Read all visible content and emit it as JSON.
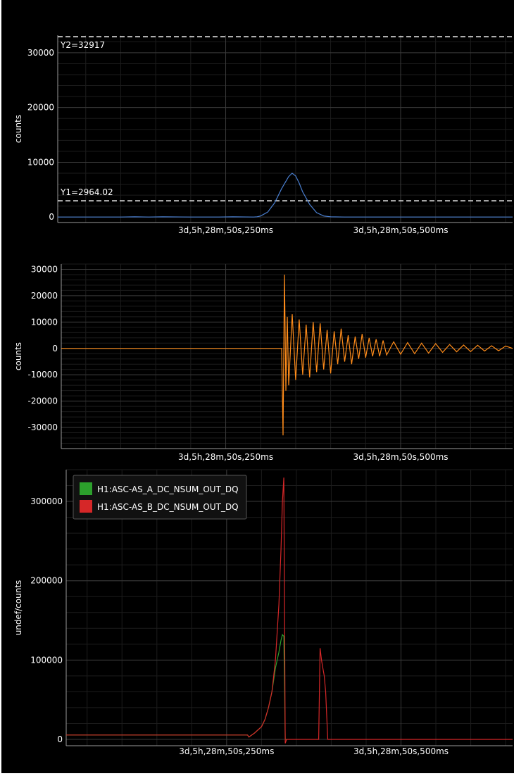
{
  "colors": {
    "background": "#000000",
    "axis": "#9a9a9a",
    "grid_major": "#3a3a3a",
    "grid_minor": "#1c1c1c",
    "text": "#ffffff",
    "series_blue": "#4a7fd0",
    "series_orange": "#ff8c1a",
    "series_green": "#2ca02c",
    "series_red": "#d62728",
    "threshold": "#e8e8e8"
  },
  "chart_data": [
    {
      "type": "line",
      "ylabel": "counts",
      "xlabel": "",
      "x_tick_labels": [
        "3d,5h,28m,50s,250ms",
        "3d,5h,28m,50s,500ms"
      ],
      "x_ticks": [
        250,
        500
      ],
      "xlim": [
        10,
        660
      ],
      "ylim": [
        -1000,
        33200
      ],
      "y_ticks": [
        0,
        10000,
        20000,
        30000
      ],
      "y_tick_labels": [
        "0",
        "10000",
        "20000",
        "30000"
      ],
      "grid": true,
      "annotations": [
        {
          "label": "Y2=32917",
          "value": 32917
        },
        {
          "label": "Y1=2964.02",
          "value": 2964.02
        }
      ],
      "series": [
        {
          "color": "#4a7fd0",
          "x": [
            10,
            100,
            120,
            140,
            160,
            200,
            240,
            260,
            290,
            295,
            300,
            310,
            320,
            330,
            340,
            345,
            350,
            355,
            360,
            370,
            380,
            390,
            400,
            420,
            660
          ],
          "y": [
            0,
            0,
            40,
            0,
            40,
            0,
            0,
            40,
            0,
            50,
            200,
            900,
            2600,
            5200,
            7400,
            8000,
            7500,
            6200,
            4600,
            2300,
            800,
            200,
            40,
            0,
            0
          ]
        }
      ]
    },
    {
      "type": "line",
      "ylabel": "counts",
      "xlabel": "",
      "x_tick_labels": [
        "3d,5h,28m,50s,250ms",
        "3d,5h,28m,50s,500ms"
      ],
      "x_ticks": [
        250,
        500
      ],
      "xlim": [
        15,
        660
      ],
      "ylim": [
        -38000,
        32000
      ],
      "y_ticks": [
        -30000,
        -20000,
        -10000,
        0,
        10000,
        20000,
        30000
      ],
      "y_tick_labels": [
        "-30000",
        "-20000",
        "-10000",
        "0",
        "10000",
        "20000",
        "30000"
      ],
      "grid": true,
      "series": [
        {
          "color": "#ff8c1a",
          "x": [
            15,
            330,
            332,
            334,
            336,
            338,
            340,
            345,
            350,
            355,
            360,
            365,
            370,
            375,
            380,
            385,
            390,
            395,
            400,
            405,
            410,
            415,
            420,
            425,
            430,
            435,
            440,
            445,
            450,
            455,
            460,
            465,
            470,
            475,
            480,
            490,
            500,
            510,
            520,
            530,
            540,
            550,
            560,
            570,
            580,
            590,
            600,
            610,
            620,
            630,
            640,
            650,
            660
          ],
          "y": [
            0,
            0,
            -33000,
            28000,
            -16000,
            12000,
            -14000,
            13000,
            -12000,
            11000,
            -10000,
            9000,
            -11000,
            10000,
            -9000,
            9500,
            -8000,
            7000,
            -9500,
            6500,
            -6000,
            7500,
            -5000,
            5000,
            -6000,
            4500,
            -4000,
            5500,
            -3500,
            4000,
            -3000,
            3500,
            -3000,
            3000,
            -2500,
            2500,
            -2200,
            2200,
            -2000,
            2000,
            -1800,
            1800,
            -1500,
            1500,
            -1300,
            1300,
            -1200,
            1200,
            -1000,
            1000,
            -900,
            900,
            0
          ]
        }
      ]
    },
    {
      "type": "line",
      "ylabel": "undef/counts",
      "xlabel": "",
      "x_tick_labels": [
        "3d,5h,28m,50s,250ms",
        "3d,5h,28m,50s,500ms"
      ],
      "x_ticks": [
        250,
        500
      ],
      "xlim": [
        20,
        660
      ],
      "ylim": [
        -8000,
        340000
      ],
      "y_ticks": [
        0,
        100000,
        200000,
        300000
      ],
      "y_tick_labels": [
        "0",
        "100000",
        "200000",
        "300000"
      ],
      "grid": true,
      "legend": "top-left",
      "series": [
        {
          "name": "H1:ASC-AS_A_DC_NSUM_OUT_DQ",
          "color": "#2ca02c",
          "x": [
            20,
            280,
            282,
            290,
            300,
            305,
            310,
            315,
            320,
            325,
            328,
            330,
            332,
            334,
            336
          ],
          "y": [
            5500,
            5500,
            3000,
            8000,
            16000,
            25000,
            40000,
            60000,
            90000,
            110000,
            125000,
            132000,
            130000,
            0,
            0
          ]
        },
        {
          "name": "H1:ASC-AS_B_DC_NSUM_OUT_DQ",
          "color": "#d62728",
          "x": [
            20,
            280,
            282,
            290,
            300,
            305,
            310,
            315,
            320,
            325,
            328,
            330,
            332,
            334,
            336,
            380,
            382,
            384,
            386,
            388,
            390,
            392,
            395,
            400,
            660
          ],
          "y": [
            5500,
            5500,
            3000,
            8000,
            16000,
            25000,
            40000,
            60000,
            100000,
            170000,
            240000,
            300000,
            330000,
            -5000,
            0,
            0,
            0,
            115000,
            100000,
            90000,
            80000,
            60000,
            0,
            0,
            0
          ]
        }
      ]
    }
  ]
}
